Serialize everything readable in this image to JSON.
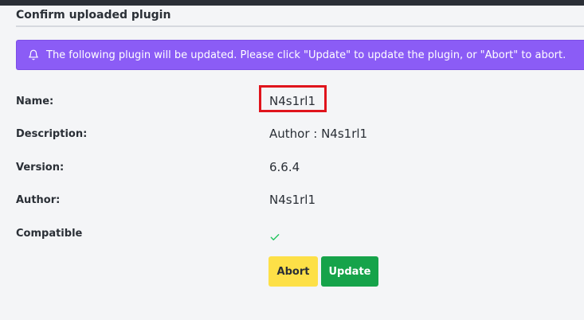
{
  "section": {
    "title": "Confirm uploaded plugin"
  },
  "alert": {
    "icon": "bell-icon",
    "message": "The following plugin will be updated. Please click \"Update\" to update the plugin, or \"Abort\" to abort.",
    "color": "#8b5cf6"
  },
  "details": {
    "name_label": "Name:",
    "name_value": "N4s1rl1",
    "description_label": "Description:",
    "description_value": "Author : N4s1rl1",
    "version_label": "Version:",
    "version_value": "6.6.4",
    "author_label": "Author:",
    "author_value": "N4s1rl1",
    "compatible_label": "Compatible",
    "compatible_icon": "checkmark-icon",
    "compatible_color": "#22c55e"
  },
  "actions": {
    "abort_label": "Abort",
    "abort_color": "#fde047",
    "update_label": "Update",
    "update_color": "#16a34a"
  },
  "annotation": {
    "highlight_color": "#e0141c"
  }
}
